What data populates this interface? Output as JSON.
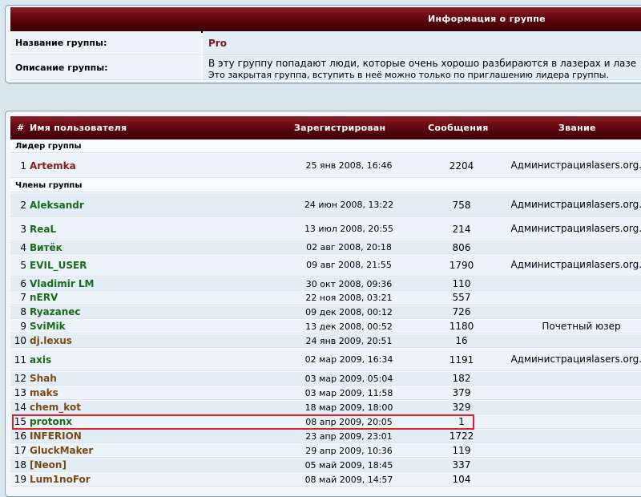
{
  "group_info": {
    "title": "Информация о группе",
    "name_label": "Название группы:",
    "name_value": "Pro",
    "desc_label": "Описание группы:",
    "desc_line1": "В эту группу попадают люди, которые очень хорошо разбираются в лазерах и лазе",
    "desc_line2": "Это закрытая группа, вступить в неё можно только по приглашению лидера группы."
  },
  "members_table": {
    "headers": {
      "num": "#",
      "username": "Имя пользователя",
      "registered": "Зарегистрирован",
      "posts": "Сообщения",
      "rank": "Звание"
    },
    "leader_section": "Лидер группы",
    "members_section": "Члены группы",
    "leader": {
      "num": "1",
      "name": "Artemka",
      "date": "25 янв 2008, 16:46",
      "posts": "2204",
      "rank1": "Администрация",
      "rank2": "lasers.org.ru"
    },
    "members": [
      {
        "num": "2",
        "name": "Aleksandr",
        "date": "24 июн 2008, 13:22",
        "posts": "758",
        "rank1": "Администрация",
        "rank2": "lasers.org.ru"
      },
      {
        "num": "3",
        "name": "ReaL",
        "date": "13 июл 2008, 20:55",
        "posts": "214",
        "rank1": "Администрация",
        "rank2": "lasers.org.ru"
      },
      {
        "num": "4",
        "name": "Витёк",
        "date": "02 авг 2008, 20:18",
        "posts": "806",
        "rank1": "",
        "rank2": ""
      },
      {
        "num": "5",
        "name": "EVIL_USER",
        "date": "09 авг 2008, 21:55",
        "posts": "1790",
        "rank1": "Администрация",
        "rank2": "lasers.org.ru"
      },
      {
        "num": "6",
        "name": "Vladimir LM",
        "date": "30 окт 2008, 09:36",
        "posts": "110",
        "rank1": "",
        "rank2": ""
      },
      {
        "num": "7",
        "name": "nERV",
        "date": "22 ноя 2008, 03:21",
        "posts": "557",
        "rank1": "",
        "rank2": ""
      },
      {
        "num": "8",
        "name": "Ryazanec",
        "date": "09 дек 2008, 00:12",
        "posts": "726",
        "rank1": "",
        "rank2": ""
      },
      {
        "num": "9",
        "name": "SviMik",
        "date": "13 дек 2008, 00:52",
        "posts": "1180",
        "rank1": "Почетный юзер",
        "rank2": ""
      },
      {
        "num": "10",
        "name": "dj.lexus",
        "date": "24 янв 2009, 20:51",
        "posts": "16",
        "rank1": "",
        "rank2": ""
      },
      {
        "num": "11",
        "name": "axis",
        "date": "02 мар 2009, 16:34",
        "posts": "1191",
        "rank1": "Администрация",
        "rank2": "lasers.org.ru"
      },
      {
        "num": "12",
        "name": "Shah",
        "date": "03 мар 2009, 05:04",
        "posts": "182",
        "rank1": "",
        "rank2": ""
      },
      {
        "num": "13",
        "name": "maks",
        "date": "03 мар 2009, 11:58",
        "posts": "379",
        "rank1": "",
        "rank2": ""
      },
      {
        "num": "14",
        "name": "chem_kot",
        "date": "18 мар 2009, 18:00",
        "posts": "329",
        "rank1": "",
        "rank2": ""
      },
      {
        "num": "15",
        "name": "protonx",
        "date": "08 апр 2009, 20:05",
        "posts": "1",
        "rank1": "",
        "rank2": ""
      },
      {
        "num": "16",
        "name": "INFERION",
        "date": "23 апр 2009, 23:01",
        "posts": "1722",
        "rank1": "",
        "rank2": ""
      },
      {
        "num": "17",
        "name": "GluckMaker",
        "date": "29 апр 2009, 10:36",
        "posts": "119",
        "rank1": "",
        "rank2": ""
      },
      {
        "num": "18",
        "name": "[Neon]",
        "date": "05 май 2009, 18:45",
        "posts": "337",
        "rank1": "",
        "rank2": ""
      },
      {
        "num": "19",
        "name": "Lum1noFor",
        "date": "08 май 2009, 14:57",
        "posts": "104",
        "rank1": "",
        "rank2": ""
      }
    ]
  },
  "colors": {
    "header_bg": "#6e0b12",
    "leader_name": "#8a1c1c",
    "member_name": "#1b6a1b",
    "highlight": "#d8222a"
  }
}
